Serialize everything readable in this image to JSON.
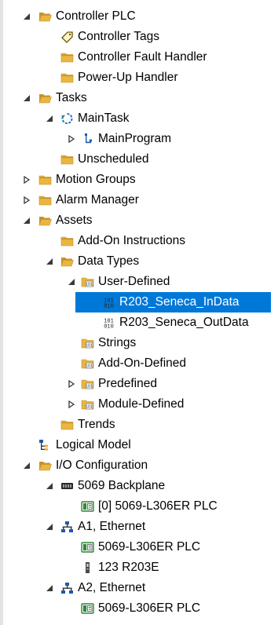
{
  "tree": {
    "items": [
      {
        "label": "Controller PLC",
        "indent": 0,
        "expand": "expanded",
        "icon": "folder-open-icon"
      },
      {
        "label": "Controller Tags",
        "indent": 1,
        "expand": "none",
        "icon": "tag-icon"
      },
      {
        "label": "Controller Fault Handler",
        "indent": 1,
        "expand": "none",
        "icon": "folder-closed-icon"
      },
      {
        "label": "Power-Up Handler",
        "indent": 1,
        "expand": "none",
        "icon": "folder-closed-icon"
      },
      {
        "label": "Tasks",
        "indent": 0,
        "expand": "expanded",
        "icon": "folder-open-icon"
      },
      {
        "label": "MainTask",
        "indent": 1,
        "expand": "expanded",
        "icon": "task-cycle-icon"
      },
      {
        "label": "MainProgram",
        "indent": 2,
        "expand": "collapsed",
        "icon": "program-icon"
      },
      {
        "label": "Unscheduled",
        "indent": 1,
        "expand": "none",
        "icon": "folder-closed-icon"
      },
      {
        "label": "Motion Groups",
        "indent": 0,
        "expand": "collapsed",
        "icon": "folder-closed-icon"
      },
      {
        "label": "Alarm Manager",
        "indent": 0,
        "expand": "collapsed",
        "icon": "folder-closed-icon"
      },
      {
        "label": "Assets",
        "indent": 0,
        "expand": "expanded",
        "icon": "folder-open-icon"
      },
      {
        "label": "Add-On Instructions",
        "indent": 1,
        "expand": "none",
        "icon": "folder-closed-icon"
      },
      {
        "label": "Data Types",
        "indent": 1,
        "expand": "expanded",
        "icon": "folder-open-icon"
      },
      {
        "label": "User-Defined",
        "indent": 2,
        "expand": "expanded",
        "icon": "datatype-folder-open-icon"
      },
      {
        "label": "R203_Seneca_InData",
        "indent": 3,
        "expand": "none",
        "icon": "binary-datatype-icon",
        "selected": true
      },
      {
        "label": "R203_Seneca_OutData",
        "indent": 3,
        "expand": "none",
        "icon": "binary-datatype-icon"
      },
      {
        "label": "Strings",
        "indent": 2,
        "expand": "none",
        "icon": "datatype-folder-icon"
      },
      {
        "label": "Add-On-Defined",
        "indent": 2,
        "expand": "none",
        "icon": "datatype-folder-icon"
      },
      {
        "label": "Predefined",
        "indent": 2,
        "expand": "collapsed",
        "icon": "datatype-folder-icon"
      },
      {
        "label": "Module-Defined",
        "indent": 2,
        "expand": "collapsed",
        "icon": "datatype-folder-icon"
      },
      {
        "label": "Trends",
        "indent": 1,
        "expand": "none",
        "icon": "folder-closed-icon"
      },
      {
        "label": "Logical Model",
        "indent": 0,
        "expand": "none",
        "icon": "logical-model-icon"
      },
      {
        "label": "I/O Configuration",
        "indent": 0,
        "expand": "expanded",
        "icon": "folder-open-icon"
      },
      {
        "label": "5069 Backplane",
        "indent": 1,
        "expand": "expanded",
        "icon": "backplane-icon"
      },
      {
        "label": "[0] 5069-L306ER PLC",
        "indent": 2,
        "expand": "none",
        "icon": "controller-module-icon"
      },
      {
        "label": "A1, Ethernet",
        "indent": 1,
        "expand": "expanded",
        "icon": "ethernet-network-icon"
      },
      {
        "label": "5069-L306ER PLC",
        "indent": 2,
        "expand": "none",
        "icon": "controller-module-icon"
      },
      {
        "label": "123 R203E",
        "indent": 2,
        "expand": "none",
        "icon": "io-device-icon"
      },
      {
        "label": "A2, Ethernet",
        "indent": 1,
        "expand": "expanded",
        "icon": "ethernet-network-icon"
      },
      {
        "label": "5069-L306ER PLC",
        "indent": 2,
        "expand": "none",
        "icon": "controller-module-icon"
      }
    ]
  },
  "colors": {
    "selection": "#0078d7",
    "folder": "#e9b640",
    "folder_dark": "#c7902a",
    "caret": "#3a3a3a",
    "task_blue": "#1a73c9",
    "network_blue": "#1e5aa8",
    "module_green": "#2f8a3c"
  }
}
